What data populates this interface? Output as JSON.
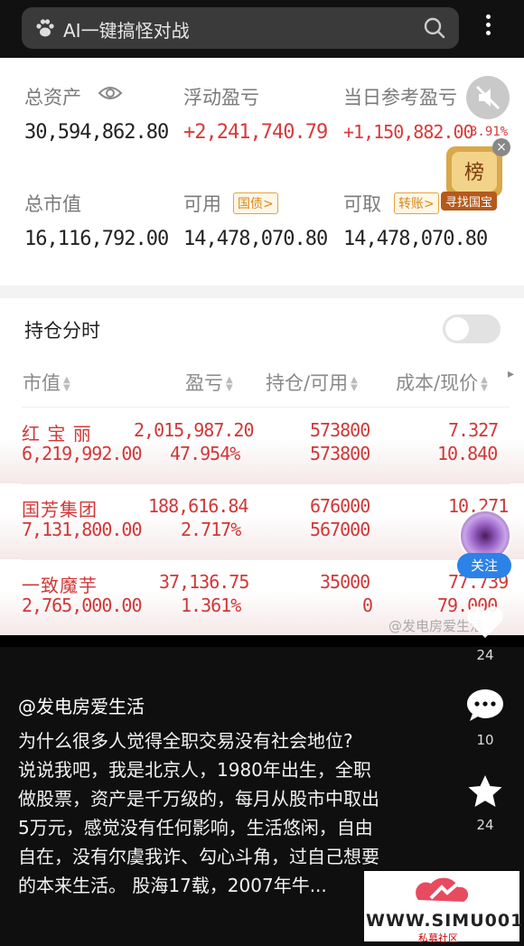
{
  "search": {
    "text": "AI一键搞怪对战"
  },
  "account": {
    "total_assets_label": "总资产",
    "total_assets": "30,594,862.80",
    "float_pl_label": "浮动盈亏",
    "float_pl": "+2,241,740.79",
    "day_pl_label": "当日参考盈亏",
    "day_pl": "+1,150,882.00",
    "day_pl_pct": "3.91%",
    "market_value_label": "总市值",
    "market_value": "16,116,792.00",
    "available_label": "可用",
    "available_tag": "国债>",
    "available": "14,478,070.80",
    "withdrawable_label": "可取",
    "withdrawable_tag": "转账>",
    "withdrawable": "14,478,070.80",
    "badge_icon_text": "榜",
    "badge_text": "寻找国宝"
  },
  "holdings": {
    "title": "持仓分时",
    "columns": [
      "市值",
      "盈亏",
      "持仓/可用",
      "成本/现价"
    ],
    "rows": [
      {
        "name": "红 宝 丽",
        "market_value": "6,219,992.00",
        "pl": "2,015,987.20",
        "pl_pct": "47.954%",
        "position": "573800",
        "available": "573800",
        "cost": "7.327",
        "price": "10.840"
      },
      {
        "name": "国芳集团",
        "market_value": "7,131,800.00",
        "pl": "188,616.84",
        "pl_pct": "2.717%",
        "position": "676000",
        "available": "567000",
        "cost": "10.271",
        "price": "1"
      },
      {
        "name": "一致魔芋",
        "market_value": "2,765,000.00",
        "pl": "37,136.75",
        "pl_pct": "1.361%",
        "position": "35000",
        "available": "0",
        "cost": "77.739",
        "price": "79.000"
      }
    ],
    "watermark": "@发电房爱生活"
  },
  "feed": {
    "author": "@发电房爱生活",
    "caption_lines": [
      "为什么很多人觉得全职交易没有社会地位?",
      "说说我吧，我是北京人，1980年出生，全职",
      "做股票，资产是千万级的，每月从股市中取出",
      "5万元，感觉没有任何影响，生活悠闲，自由",
      "自在，没有尔虞我诈、勾心斗角，过自己想要",
      "的本来生活。 股海17载，2007年牛..."
    ],
    "follow_label": "关注",
    "likes": "24",
    "comments": "10",
    "favorites": "24"
  },
  "logo": {
    "main": "WWW.SIMU001.CN",
    "sub": "私募社区"
  }
}
